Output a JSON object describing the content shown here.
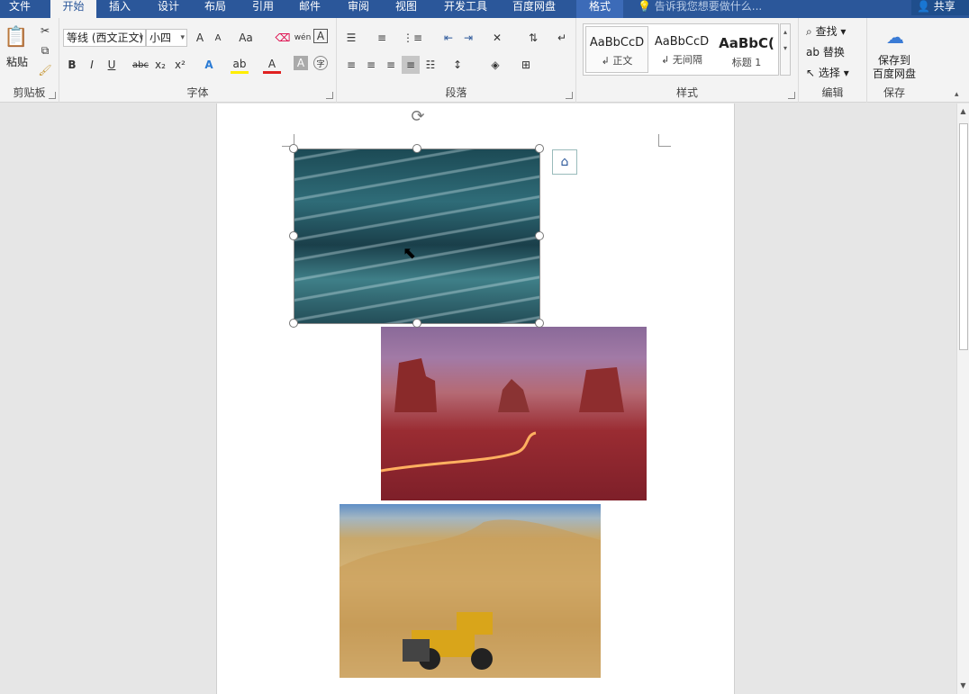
{
  "tabs": [
    "文件",
    "开始",
    "插入",
    "设计",
    "布局",
    "引用",
    "邮件",
    "审阅",
    "视图",
    "开发工具",
    "百度网盘",
    "格式"
  ],
  "tell_me": "告诉我您想要做什么...",
  "share": "共享",
  "groups": {
    "clipboard": "剪贴板",
    "font": "字体",
    "paragraph": "段落",
    "styles": "样式",
    "editing": "编辑",
    "save": "保存"
  },
  "clipboard": {
    "paste": "粘贴"
  },
  "font": {
    "name": "等线 (西文正文)",
    "size": "小四",
    "bold": "B",
    "italic": "I",
    "underline": "U",
    "strike": "abc",
    "sub": "x₂",
    "sup": "x²",
    "grow": "A",
    "shrink": "A",
    "case": "Aa",
    "phonetic": "wén",
    "border_char": "A"
  },
  "styles": [
    {
      "sample": "AaBbCcD",
      "name": "↲ 正文"
    },
    {
      "sample": "AaBbCcD",
      "name": "↲ 无间隔"
    },
    {
      "sample": "AaBbC(",
      "name": "标题 1"
    }
  ],
  "editing": {
    "find": "查找",
    "replace": "替换",
    "select": "选择"
  },
  "save": {
    "line1": "保存到",
    "line2": "百度网盘"
  },
  "images": [
    "ocean-waves",
    "desert-buttes-night",
    "sand-quarry-loader"
  ]
}
